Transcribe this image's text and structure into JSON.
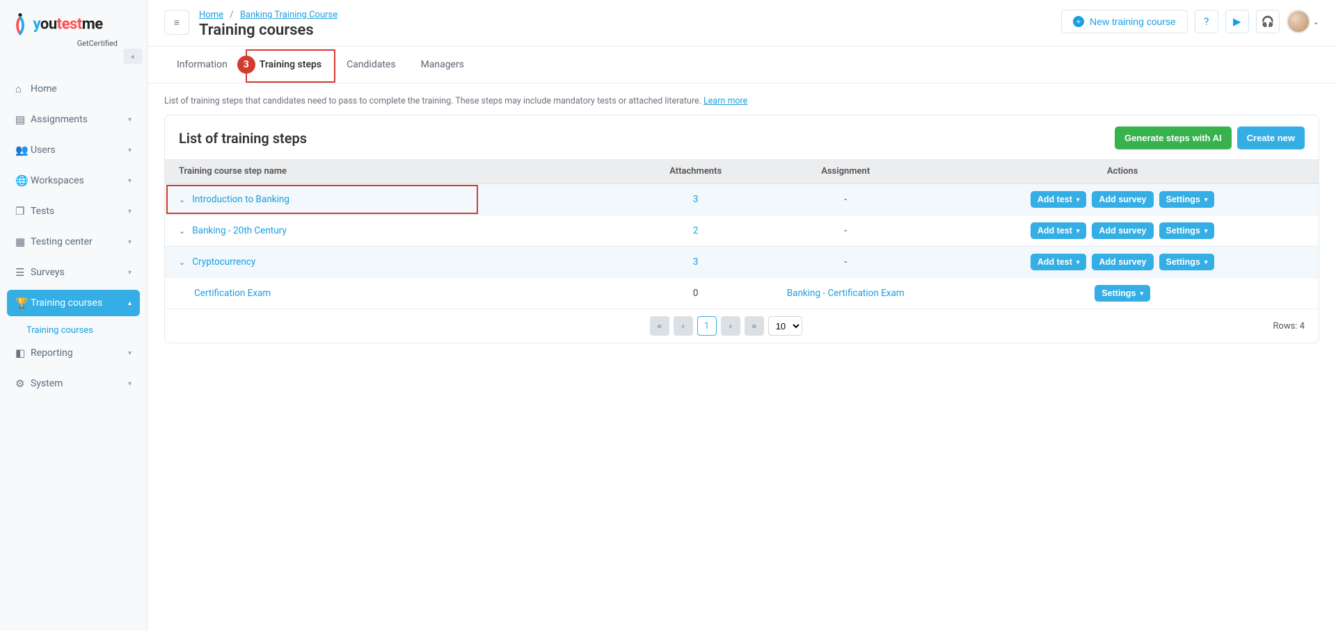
{
  "logo": {
    "subtitle": "GetCertified"
  },
  "sidebar": {
    "items": [
      {
        "label": "Home"
      },
      {
        "label": "Assignments"
      },
      {
        "label": "Users"
      },
      {
        "label": "Workspaces"
      },
      {
        "label": "Tests"
      },
      {
        "label": "Testing center"
      },
      {
        "label": "Surveys"
      },
      {
        "label": "Training courses"
      },
      {
        "label": "Reporting"
      },
      {
        "label": "System"
      }
    ],
    "sub_training_courses": "Training courses"
  },
  "breadcrumb": {
    "home": "Home",
    "course": "Banking Training Course"
  },
  "page_title": "Training courses",
  "topbar": {
    "new_course": "New training course"
  },
  "tabs": {
    "information": "Information",
    "training_steps": "Training steps",
    "candidates": "Candidates",
    "managers": "Managers",
    "annot_num": "3"
  },
  "help": {
    "text": "List of training steps that candidates need to pass to complete the training. These steps may include mandatory tests or attached literature. ",
    "learn_more": "Learn more"
  },
  "panel": {
    "title": "List of training steps",
    "generate_ai": "Generate steps with AI",
    "create_new": "Create new"
  },
  "table": {
    "headers": {
      "name": "Training course step name",
      "attachments": "Attachments",
      "assignment": "Assignment",
      "actions": "Actions"
    },
    "rows": [
      {
        "name": "Introduction to Banking",
        "attachments": "3",
        "assignment": "-",
        "expandable": true,
        "highlighted": true
      },
      {
        "name": "Banking - 20th Century",
        "attachments": "2",
        "assignment": "-",
        "expandable": true
      },
      {
        "name": "Cryptocurrency",
        "attachments": "3",
        "assignment": "-",
        "expandable": true
      },
      {
        "name": "Certification Exam",
        "attachments": "0",
        "assignment": "Banking - Certification Exam",
        "expandable": false,
        "settings_only": true
      }
    ],
    "action_labels": {
      "add_test": "Add test",
      "add_survey": "Add survey",
      "settings": "Settings"
    }
  },
  "pager": {
    "current": "1",
    "page_size": "10",
    "rows_label": "Rows: 4"
  }
}
